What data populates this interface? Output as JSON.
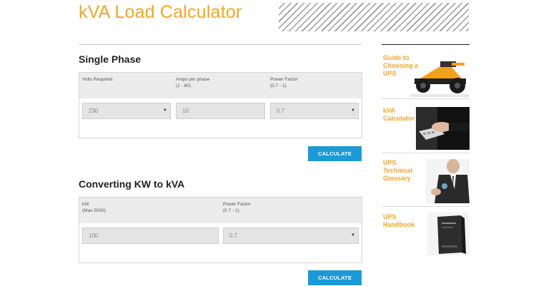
{
  "page": {
    "title": "kVA Load Calculator"
  },
  "single_phase": {
    "title": "Single Phase",
    "labels": {
      "volts": "Volts Required",
      "amps": "Amps per phase",
      "amps_range": "(1 - 80)",
      "pf": "Power Factor",
      "pf_range": "(0.7 - 1)"
    },
    "volts_value": "230",
    "amps_value": "10",
    "pf_value": "0.7",
    "button": "CALCULATE"
  },
  "kw_kva": {
    "title": "Converting KW to kVA",
    "labels": {
      "kw": "kW",
      "kw_range": "(Max 5000)",
      "pf": "Power Factor",
      "pf_range": "(0.7 - 1)"
    },
    "kw_value": "100",
    "pf_value": "0.7",
    "button": "CALCULATE"
  },
  "sidebar": {
    "items": [
      {
        "line1": "Guide to",
        "line2": "Choosing a",
        "line3": "UPS"
      },
      {
        "line1": "kVA",
        "line2": "Calculator",
        "line3": ""
      },
      {
        "line1": "UPS",
        "line2": "Technical",
        "line3": "Glossary"
      },
      {
        "line1": "UPS",
        "line2": "Handbook",
        "line3": ""
      }
    ]
  },
  "colors": {
    "accent": "#f5a623",
    "button": "#1a9bd7"
  }
}
